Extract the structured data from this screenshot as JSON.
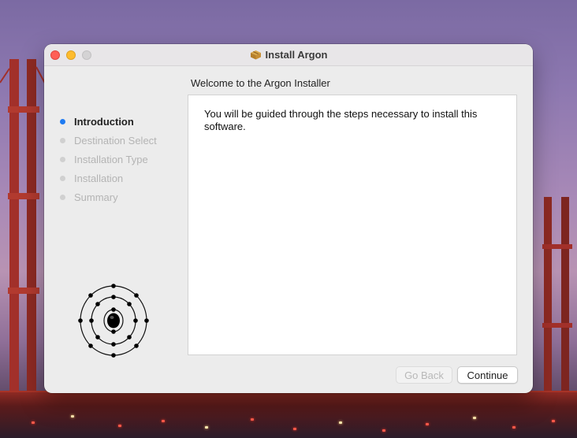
{
  "window": {
    "title": "Install Argon",
    "title_icon": "package-icon"
  },
  "header": {
    "welcome": "Welcome to the Argon Installer"
  },
  "sidebar": {
    "steps": [
      {
        "label": "Introduction",
        "active": true
      },
      {
        "label": "Destination Select",
        "active": false
      },
      {
        "label": "Installation Type",
        "active": false
      },
      {
        "label": "Installation",
        "active": false
      },
      {
        "label": "Summary",
        "active": false
      }
    ],
    "logo": "argon-atom-icon"
  },
  "content": {
    "body_text": "You will be guided through the steps necessary to install this software."
  },
  "buttons": {
    "back_label": "Go Back",
    "back_enabled": false,
    "continue_label": "Continue",
    "continue_enabled": true
  },
  "colors": {
    "active_step": "#1f7bf2",
    "close": "#ff5f57",
    "minimize": "#febc2e",
    "zoom_inactive": "#d4d3d4"
  }
}
